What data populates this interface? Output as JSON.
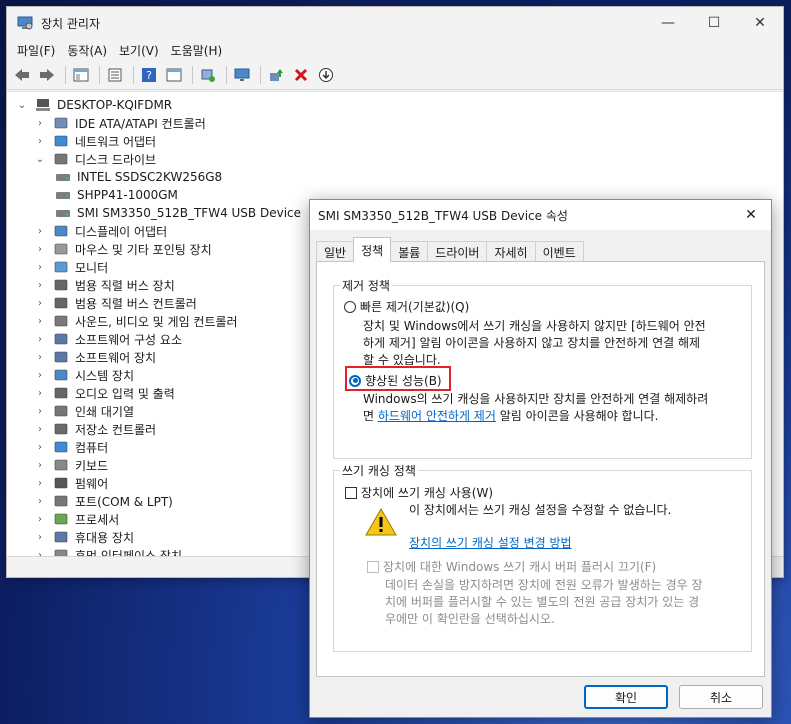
{
  "window": {
    "title": "장치 관리자"
  },
  "menu": [
    "파일(F)",
    "동작(A)",
    "보기(V)",
    "도움말(H)"
  ],
  "tree": {
    "root": "DESKTOP-KQIFDMR",
    "items": [
      {
        "label": "IDE ATA/ATAPI 컨트롤러",
        "expanded": false
      },
      {
        "label": "네트워크 어댑터",
        "expanded": false
      },
      {
        "label": "디스크 드라이브",
        "expanded": true
      },
      {
        "label": "INTEL SSDSC2KW256G8",
        "child": true
      },
      {
        "label": "SHPP41-1000GM",
        "child": true
      },
      {
        "label": "SMI SM3350_512B_TFW4 USB Device",
        "child": true
      },
      {
        "label": "디스플레이 어댑터",
        "expanded": false
      },
      {
        "label": "마우스 및 기타 포인팅 장치",
        "expanded": false
      },
      {
        "label": "모니터",
        "expanded": false
      },
      {
        "label": "범용 직렬 버스 장치",
        "expanded": false
      },
      {
        "label": "범용 직렬 버스 컨트롤러",
        "expanded": false
      },
      {
        "label": "사운드, 비디오 및 게임 컨트롤러",
        "expanded": false
      },
      {
        "label": "소프트웨어 구성 요소",
        "expanded": false
      },
      {
        "label": "소프트웨어 장치",
        "expanded": false
      },
      {
        "label": "시스템 장치",
        "expanded": false
      },
      {
        "label": "오디오 입력 및 출력",
        "expanded": false
      },
      {
        "label": "인쇄 대기열",
        "expanded": false
      },
      {
        "label": "저장소 컨트롤러",
        "expanded": false
      },
      {
        "label": "컴퓨터",
        "expanded": false
      },
      {
        "label": "키보드",
        "expanded": false
      },
      {
        "label": "펌웨어",
        "expanded": false
      },
      {
        "label": "포트(COM & LPT)",
        "expanded": false
      },
      {
        "label": "프로세서",
        "expanded": false
      },
      {
        "label": "휴대용 장치",
        "expanded": false
      },
      {
        "label": "휴먼 인터페이스 장치",
        "expanded": false
      }
    ]
  },
  "dialog": {
    "title": "SMI SM3350_512B_TFW4 USB Device 속성",
    "close": "✕",
    "tabs": [
      "일반",
      "정책",
      "볼륨",
      "드라이버",
      "자세히",
      "이벤트"
    ],
    "active_tab": "정책",
    "removal": {
      "legend": "제거 정책",
      "quick_label": "빠른 제거(기본값)(Q)",
      "quick_desc_1": "장치 및 Windows에서 쓰기 캐싱을 사용하지 않지만 [하드웨어 안전",
      "quick_desc_2": "하게 제거] 알림 아이콘을 사용하지 않고 장치를 안전하게 연결 해제",
      "quick_desc_3": "할 수 있습니다.",
      "better_label": "향상된 성능(B)",
      "better_desc_1": "Windows의 쓰기 캐싱을 사용하지만 장치를 안전하게 연결 해제하려",
      "better_desc_2_pre": "면 ",
      "better_desc_link": "하드웨어 안전하게 제거",
      "better_desc_2_post": " 알림 아이콘을 사용해야 합니다."
    },
    "caching": {
      "legend": "쓰기 캐싱 정책",
      "enable_label": "장치에 쓰기 캐싱 사용(W)",
      "warning_text": "이 장치에서는 쓰기 캐싱 설정을 수정할 수 없습니다.",
      "change_link": "장치의 쓰기 캐싱 설정 변경 방법",
      "flush_label": "장치에 대한 Windows 쓰기 캐시 버퍼 플러시 끄기(F)",
      "flush_desc_1": "데이터 손실을 방지하려면 장치에 전원 오류가 발생하는 경우 장",
      "flush_desc_2": "치에 버퍼를 플러시할 수 있는 별도의 전원 공급 장치가 있는 경",
      "flush_desc_3": "우에만 이 확인란을 선택하십시오."
    },
    "ok": "확인",
    "cancel": "취소"
  },
  "colors": {
    "accent": "#0067c0",
    "highlight_box": "#e0202a",
    "link": "#0066cc"
  }
}
